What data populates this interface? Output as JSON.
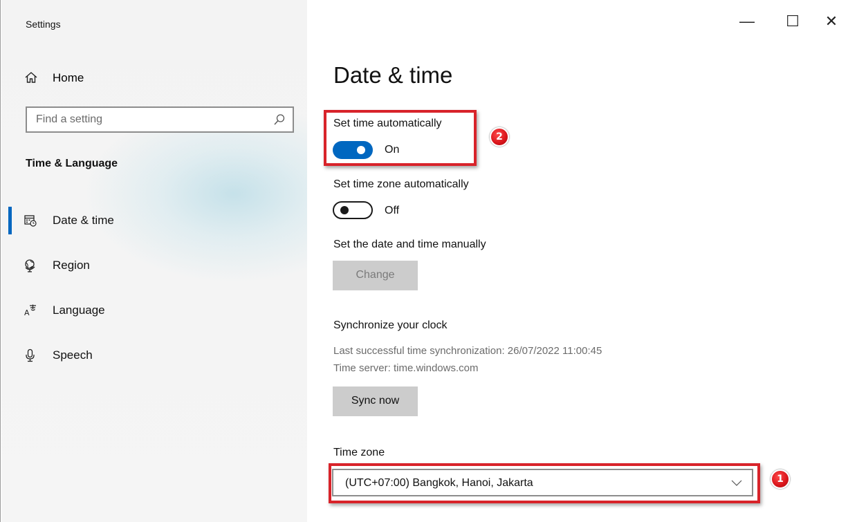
{
  "window": {
    "title": "Settings",
    "controls": {
      "minimize": "—",
      "maximize": "☐",
      "close": "✕"
    }
  },
  "sidebar": {
    "home_label": "Home",
    "search_placeholder": "Find a setting",
    "section_title": "Time & Language",
    "items": [
      {
        "label": "Date & time",
        "icon": "calendar-clock-icon",
        "selected": true
      },
      {
        "label": "Region",
        "icon": "globe-icon",
        "selected": false
      },
      {
        "label": "Language",
        "icon": "language-icon",
        "selected": false
      },
      {
        "label": "Speech",
        "icon": "microphone-icon",
        "selected": false
      }
    ]
  },
  "main": {
    "title": "Date & time",
    "auto_time": {
      "label": "Set time automatically",
      "state": "On"
    },
    "auto_timezone": {
      "label": "Set time zone automatically",
      "state": "Off"
    },
    "manual": {
      "label": "Set the date and time manually",
      "button": "Change"
    },
    "sync": {
      "heading": "Synchronize your clock",
      "last_sync": "Last successful time synchronization: 26/07/2022 11:00:45",
      "server": "Time server: time.windows.com",
      "button": "Sync now"
    },
    "timezone": {
      "label": "Time zone",
      "value": "(UTC+07:00) Bangkok, Hanoi, Jakarta"
    }
  },
  "annotations": {
    "badge_1": "1",
    "badge_2": "2"
  },
  "colors": {
    "accent": "#0067c0",
    "highlight": "#d8232a"
  }
}
